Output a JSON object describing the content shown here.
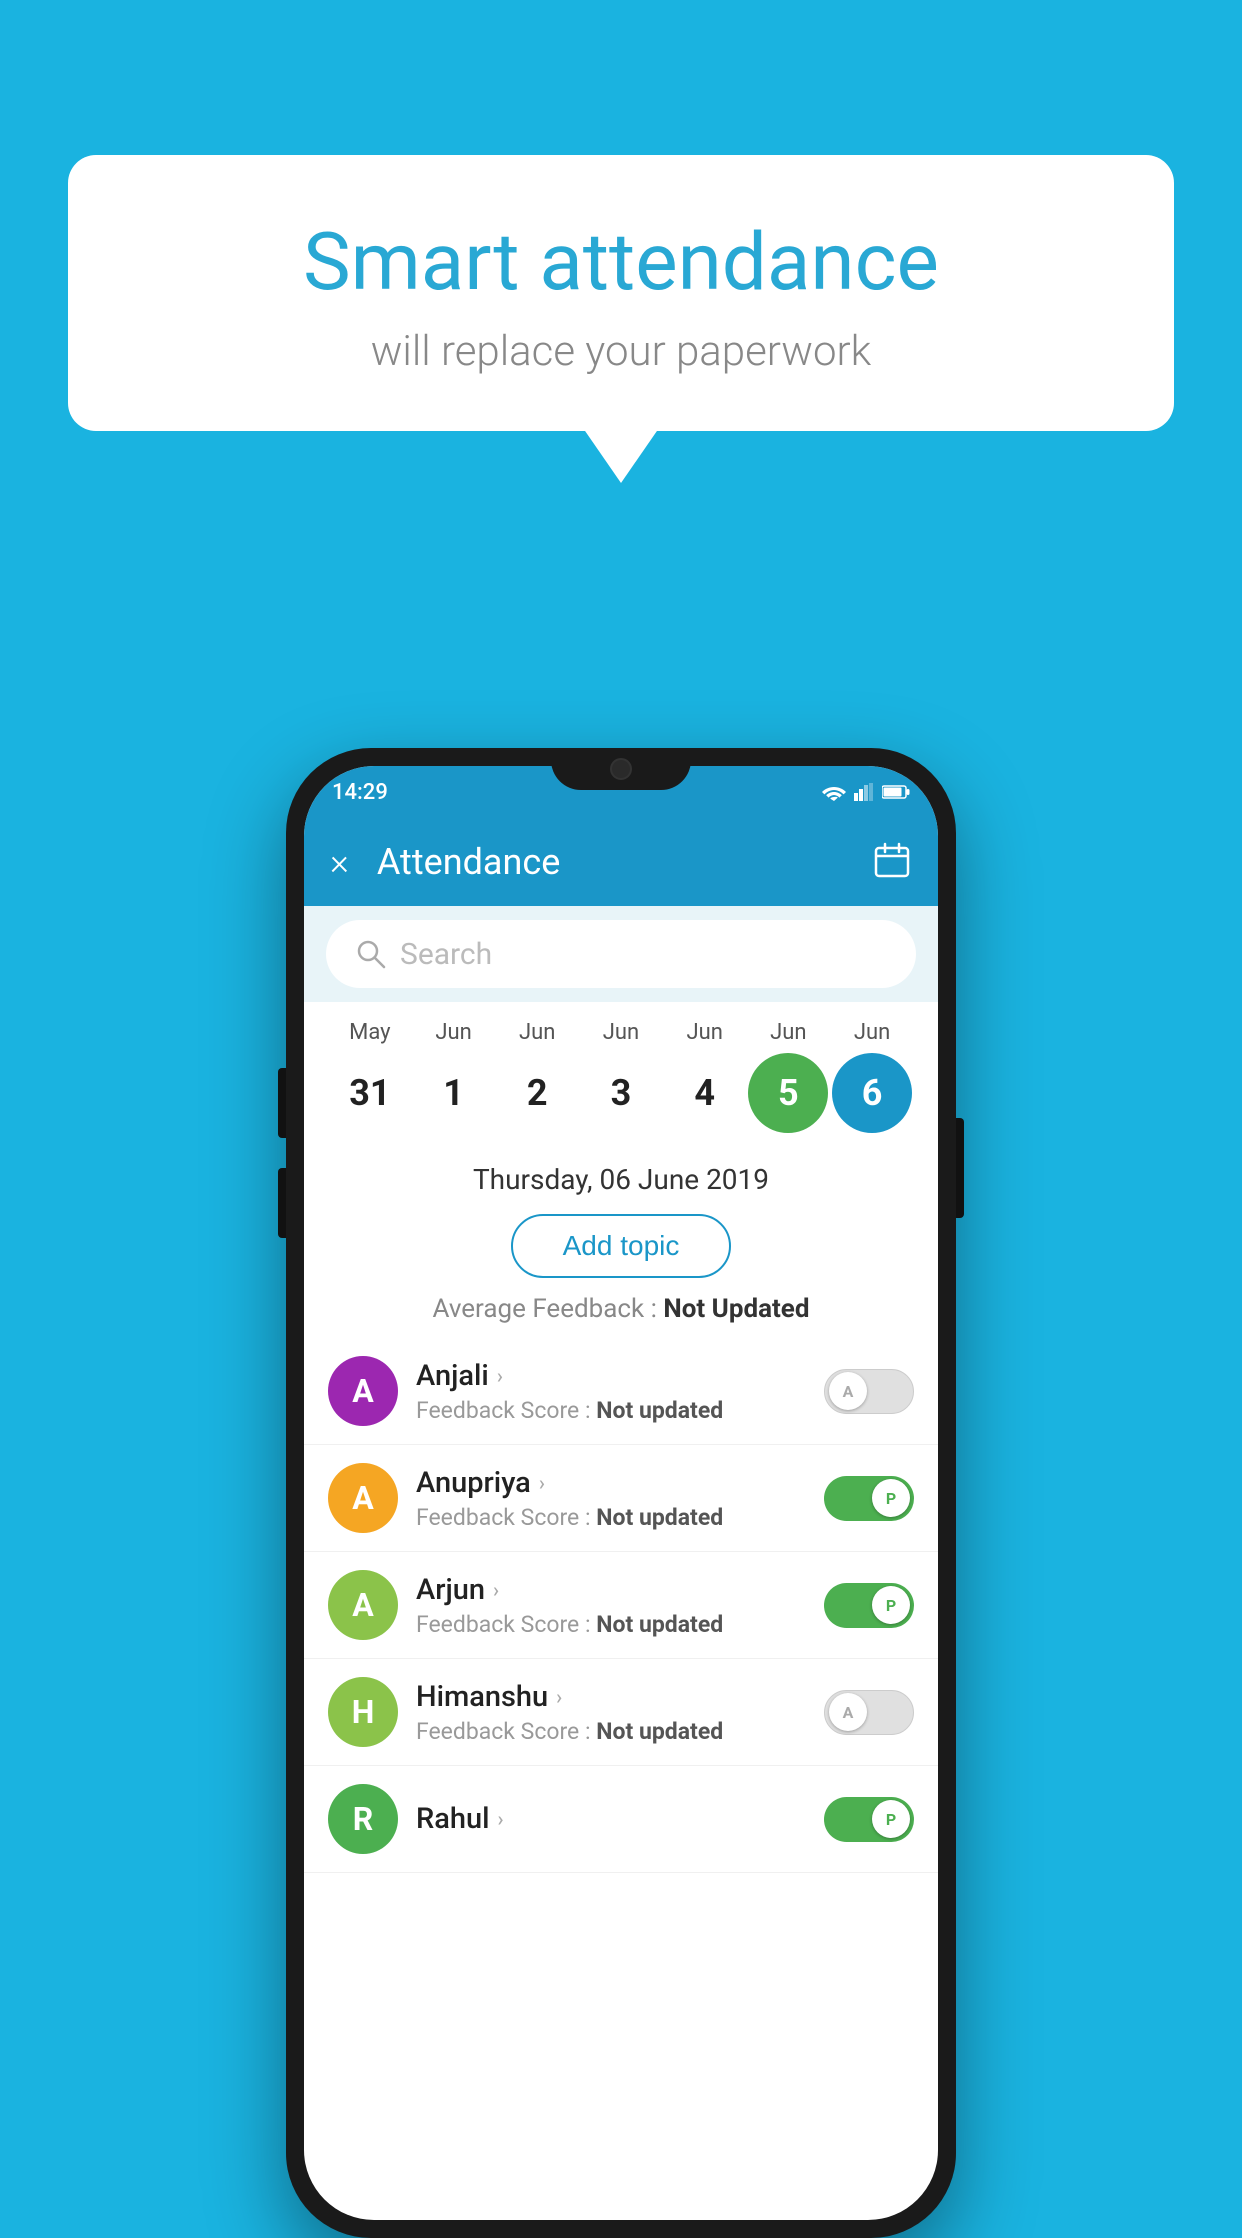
{
  "background_color": "#1ab3e0",
  "speech_bubble": {
    "title": "Smart attendance",
    "subtitle": "will replace your paperwork"
  },
  "status_bar": {
    "time": "14:29"
  },
  "app_bar": {
    "title": "Attendance",
    "close_label": "×"
  },
  "search": {
    "placeholder": "Search"
  },
  "calendar": {
    "months": [
      "May",
      "Jun",
      "Jun",
      "Jun",
      "Jun",
      "Jun",
      "Jun"
    ],
    "dates": [
      "31",
      "1",
      "2",
      "3",
      "4",
      "5",
      "6"
    ],
    "today_index": 5,
    "selected_index": 6
  },
  "selected_date_label": "Thursday, 06 June 2019",
  "add_topic_button": "Add topic",
  "average_feedback_label": "Average Feedback :",
  "average_feedback_value": "Not Updated",
  "students": [
    {
      "name": "Anjali",
      "avatar_letter": "A",
      "avatar_color": "#9c27b0",
      "feedback_label": "Feedback Score :",
      "feedback_value": "Not updated",
      "toggle": "off",
      "toggle_label": "A"
    },
    {
      "name": "Anupriya",
      "avatar_letter": "A",
      "avatar_color": "#f5a623",
      "feedback_label": "Feedback Score :",
      "feedback_value": "Not updated",
      "toggle": "on",
      "toggle_label": "P"
    },
    {
      "name": "Arjun",
      "avatar_letter": "A",
      "avatar_color": "#8bc34a",
      "feedback_label": "Feedback Score :",
      "feedback_value": "Not updated",
      "toggle": "on",
      "toggle_label": "P"
    },
    {
      "name": "Himanshu",
      "avatar_letter": "H",
      "avatar_color": "#8bc34a",
      "feedback_label": "Feedback Score :",
      "feedback_value": "Not updated",
      "toggle": "off",
      "toggle_label": "A"
    }
  ]
}
